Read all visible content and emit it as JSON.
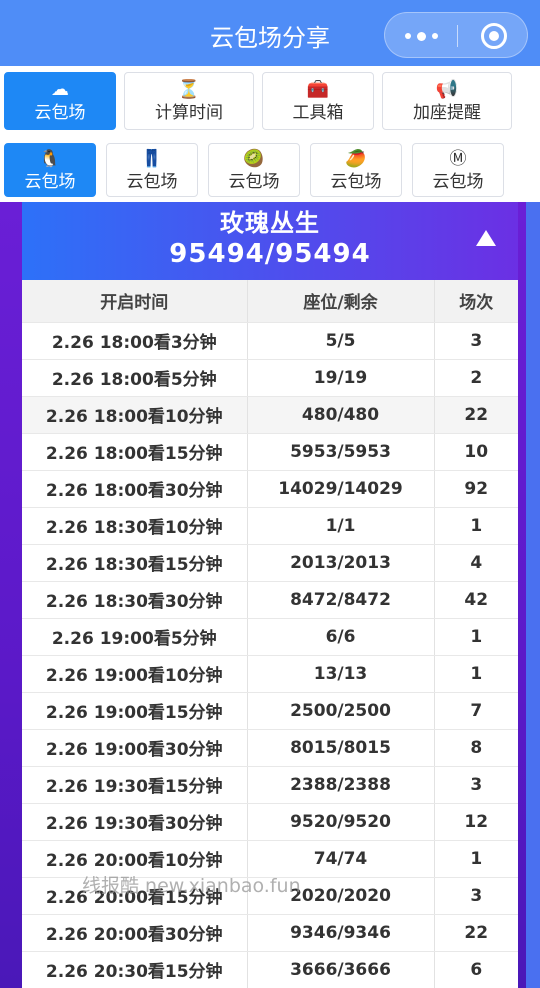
{
  "app": {
    "title": "云包场分享"
  },
  "capsule": {
    "more_icon": "more-dots-icon",
    "close_icon": "target-close-icon"
  },
  "tabs_primary": [
    {
      "label": "云包场",
      "icon": "☁",
      "active": true
    },
    {
      "label": "计算时间",
      "icon": "⏳",
      "active": false
    },
    {
      "label": "工具箱",
      "icon": "🧰",
      "active": false
    },
    {
      "label": "加座提醒",
      "icon": "📢",
      "active": false
    }
  ],
  "tabs_secondary": [
    {
      "label": "云包场",
      "icon": "🐧",
      "active": true
    },
    {
      "label": "云包场",
      "icon": "👖",
      "active": false
    },
    {
      "label": "云包场",
      "icon": "🥝",
      "active": false
    },
    {
      "label": "云包场",
      "icon": "🥭",
      "active": false
    },
    {
      "label": "云包场",
      "icon": "Ⓜ",
      "active": false
    }
  ],
  "card": {
    "name": "玫瑰丛生",
    "count": "95494/95494",
    "collapse_icon": "triangle-up-icon"
  },
  "table": {
    "headers": [
      "开启时间",
      "座位/剩余",
      "场次"
    ],
    "rows": [
      [
        "2.26 18:00看3分钟",
        "5/5",
        "3"
      ],
      [
        "2.26 18:00看5分钟",
        "19/19",
        "2"
      ],
      [
        "2.26 18:00看10分钟",
        "480/480",
        "22"
      ],
      [
        "2.26 18:00看15分钟",
        "5953/5953",
        "10"
      ],
      [
        "2.26 18:00看30分钟",
        "14029/14029",
        "92"
      ],
      [
        "2.26 18:30看10分钟",
        "1/1",
        "1"
      ],
      [
        "2.26 18:30看15分钟",
        "2013/2013",
        "4"
      ],
      [
        "2.26 18:30看30分钟",
        "8472/8472",
        "42"
      ],
      [
        "2.26 19:00看5分钟",
        "6/6",
        "1"
      ],
      [
        "2.26 19:00看10分钟",
        "13/13",
        "1"
      ],
      [
        "2.26 19:00看15分钟",
        "2500/2500",
        "7"
      ],
      [
        "2.26 19:00看30分钟",
        "8015/8015",
        "8"
      ],
      [
        "2.26 19:30看15分钟",
        "2388/2388",
        "3"
      ],
      [
        "2.26 19:30看30分钟",
        "9520/9520",
        "12"
      ],
      [
        "2.26 20:00看10分钟",
        "74/74",
        "1"
      ],
      [
        "2.26 20:00看15分钟",
        "2020/2020",
        "3"
      ],
      [
        "2.26 20:00看30分钟",
        "9346/9346",
        "22"
      ],
      [
        "2.26 20:30看15分钟",
        "3666/3666",
        "6"
      ]
    ]
  },
  "watermark": "线报酷 new.xianbao.fun",
  "colors": {
    "topbar": "#4f8df7",
    "tab_active": "#1e88f5",
    "card_header_start": "#2d71f8",
    "card_header_end": "#6b30e4",
    "background_purple": "#5b19c8"
  }
}
